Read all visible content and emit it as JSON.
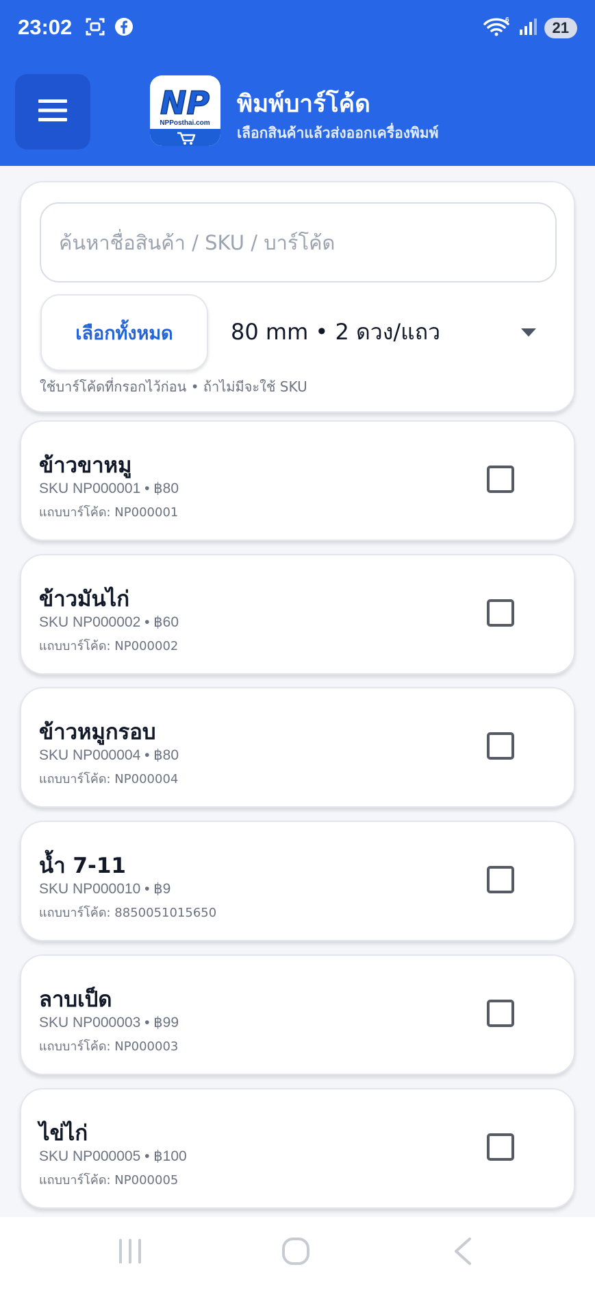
{
  "status_bar": {
    "time": "23:02",
    "icons_left": [
      "screenshot-icon",
      "facebook-icon"
    ],
    "icons_right": [
      "wifi-icon",
      "signal-icon"
    ],
    "battery": "21"
  },
  "app_bar": {
    "title": "พิมพ์บาร์โค้ด",
    "subtitle": "เลือกสินค้าแล้วส่งออกเครื่องพิมพ์",
    "logo_text": "NP",
    "logo_caption": "NPPosthai.com"
  },
  "search": {
    "placeholder": "ค้นหาชื่อสินค้า / SKU / บาร์โค้ด",
    "value": ""
  },
  "controls": {
    "select_all_label": "เลือกทั้งหมด",
    "size_selected": "80 mm • 2 ดวง/แถว",
    "hint": "ใช้บาร์โค้ดที่กรอกไว้ก่อน • ถ้าไม่มีจะใช้ SKU"
  },
  "products": [
    {
      "name": "ข้าวขาหมู",
      "sku_line": "SKU NP000001 • ฿80",
      "barcode_line": "แถบบาร์โค้ด: NP000001",
      "checked": false
    },
    {
      "name": "ข้าวมันไก่",
      "sku_line": "SKU NP000002 • ฿60",
      "barcode_line": "แถบบาร์โค้ด: NP000002",
      "checked": false
    },
    {
      "name": "ข้าวหมูกรอบ",
      "sku_line": "SKU NP000004 • ฿80",
      "barcode_line": "แถบบาร์โค้ด: NP000004",
      "checked": false
    },
    {
      "name": "น้ำ 7-11",
      "sku_line": "SKU NP000010 • ฿9",
      "barcode_line": "แถบบาร์โค้ด: 8850051015650",
      "checked": false
    },
    {
      "name": "ลาบเป็ด",
      "sku_line": "SKU NP000003 • ฿99",
      "barcode_line": "แถบบาร์โค้ด: NP000003",
      "checked": false
    },
    {
      "name": "ไข่ไก่",
      "sku_line": "SKU NP000005 • ฿100",
      "barcode_line": "แถบบาร์โค้ด: NP000005",
      "checked": false
    }
  ],
  "colors": {
    "primary": "#2766e6",
    "menu_button": "#1f55d0",
    "accent_text": "#2563d9",
    "background": "#f4f6f9"
  }
}
